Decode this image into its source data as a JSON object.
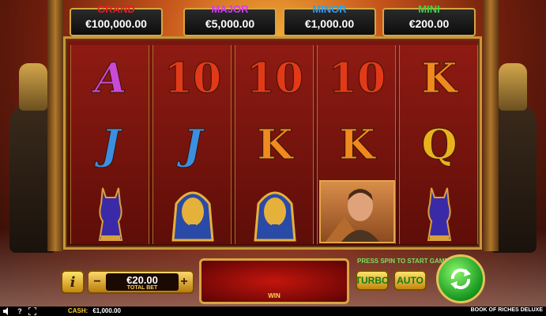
{
  "jackpots": [
    {
      "label": "GRAND",
      "value": "€100,000.00",
      "color": "#e02020"
    },
    {
      "label": "MAJOR",
      "value": "€5,000.00",
      "color": "#d33cf0"
    },
    {
      "label": "MINOR",
      "value": "€1,000.00",
      "color": "#2e9ff5"
    },
    {
      "label": "MINI",
      "value": "€200.00",
      "color": "#3fd14a"
    }
  ],
  "reels": [
    [
      "A",
      "J",
      "bastet-cat"
    ],
    [
      "10",
      "J",
      "pharaoh-mask"
    ],
    [
      "10",
      "K",
      "pharaoh-mask"
    ],
    [
      "10",
      "K",
      "explorer"
    ],
    [
      "K",
      "Q",
      "bastet-cat"
    ]
  ],
  "controls": {
    "info_label": "i",
    "bet_minus": "−",
    "bet_plus": "+",
    "bet_value": "€20.00",
    "bet_label": "TOTAL BET",
    "win_label": "WIN",
    "press_spin_text": "PRESS SPIN TO START GAME",
    "turbo_label": "TURBO",
    "auto_label": "AUTO"
  },
  "footer": {
    "cash_label": "CASH:",
    "cash_value": "€1,000.00",
    "game_name": "BOOK OF RICHES DELUXE",
    "icons": [
      "volume-icon",
      "help-icon",
      "fullscreen-icon"
    ]
  }
}
